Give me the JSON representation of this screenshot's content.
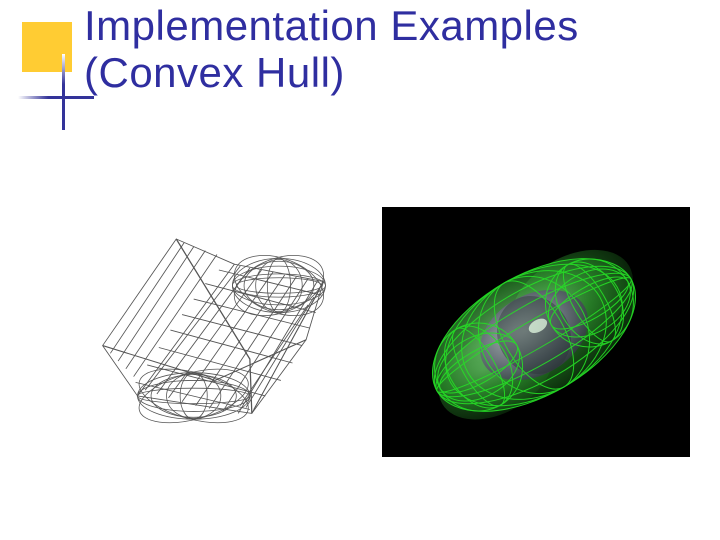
{
  "slide": {
    "title_line1": "Implementation Examples",
    "title_line2": "(Convex Hull)"
  },
  "figures": {
    "left": {
      "description": "Grayscale wireframe drawing of the convex hull of two overlapping ellipsoids, shown as a dense quad mesh on white background."
    },
    "right": {
      "description": "Green translucent rendering of the convex hull of two overlapping ellipsoids with a purple interior core, shown as a shaded surface with green wireframe on black background."
    }
  },
  "style": {
    "accent": "#ffcc33",
    "title_color": "#2f2ea0",
    "wire_stroke": "#4a4a4a",
    "right_wire": "#22cc22",
    "right_surface": "#2a8c2a",
    "right_core": "#6a4e7a"
  }
}
